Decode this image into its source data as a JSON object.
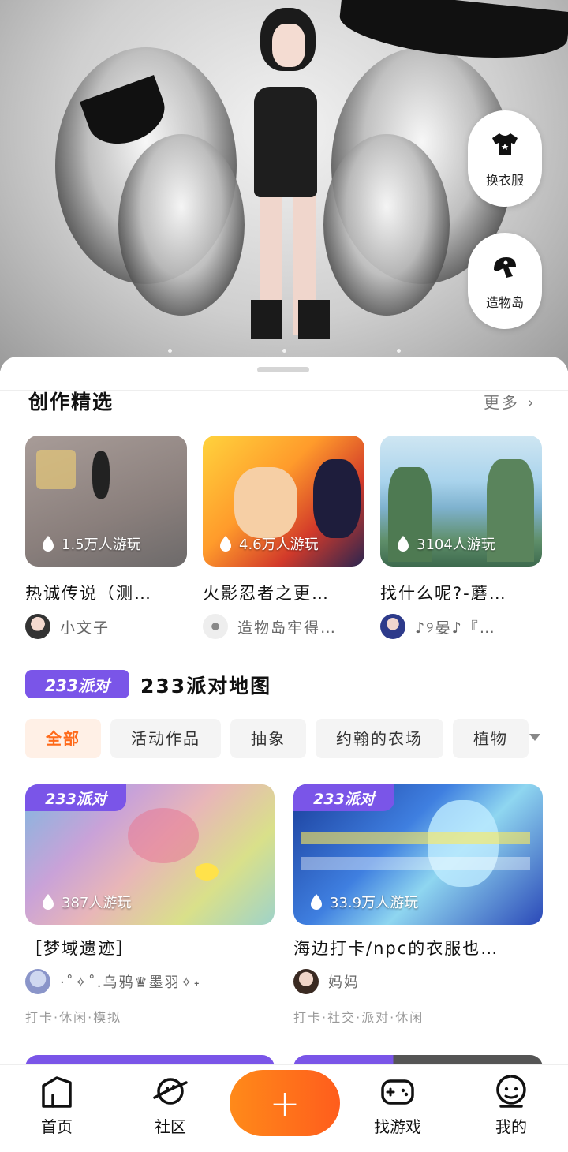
{
  "hero": {
    "side_buttons": [
      {
        "label": "换衣服",
        "icon": "shirt-icon"
      },
      {
        "label": "造物岛",
        "icon": "island-icon"
      }
    ]
  },
  "creation": {
    "title": "创作精选",
    "more_label": "更多",
    "cards": [
      {
        "plays": "1.5万人游玩",
        "title": "热诚传说（测…",
        "author": "小文子"
      },
      {
        "plays": "4.6万人游玩",
        "title": "火影忍者之更…",
        "author": "造物岛牢得…"
      },
      {
        "plays": "3104人游玩",
        "title": "找什么呢?-蘑…",
        "author": "♪୨晏♪『…"
      }
    ]
  },
  "party": {
    "badge": "233派对",
    "title": "233派对地图",
    "chips": [
      "全部",
      "活动作品",
      "抽象",
      "约翰的农场",
      "植物"
    ],
    "active_chip": "全部",
    "cards": [
      {
        "badge": "233派对",
        "plays": "387人游玩",
        "title": "［梦域遗迹］",
        "author": "·˚✧˚.乌鸦♛墨羽✧˖",
        "tags": "打卡·休闲·模拟"
      },
      {
        "badge": "233派对",
        "plays": "33.9万人游玩",
        "title": "海边打卡/npc的衣服也…",
        "author": "妈妈",
        "tags": "打卡·社交·派对·休闲"
      }
    ]
  },
  "nav": {
    "items": [
      {
        "label": "首页",
        "icon": "home-icon"
      },
      {
        "label": "社区",
        "icon": "planet-icon"
      },
      {
        "label": "+",
        "icon": "plus-icon"
      },
      {
        "label": "找游戏",
        "icon": "gamepad-icon"
      },
      {
        "label": "我的",
        "icon": "profile-icon"
      }
    ]
  },
  "colors": {
    "accent": "#ff6a1a",
    "party_purple": "#7a55e8"
  }
}
